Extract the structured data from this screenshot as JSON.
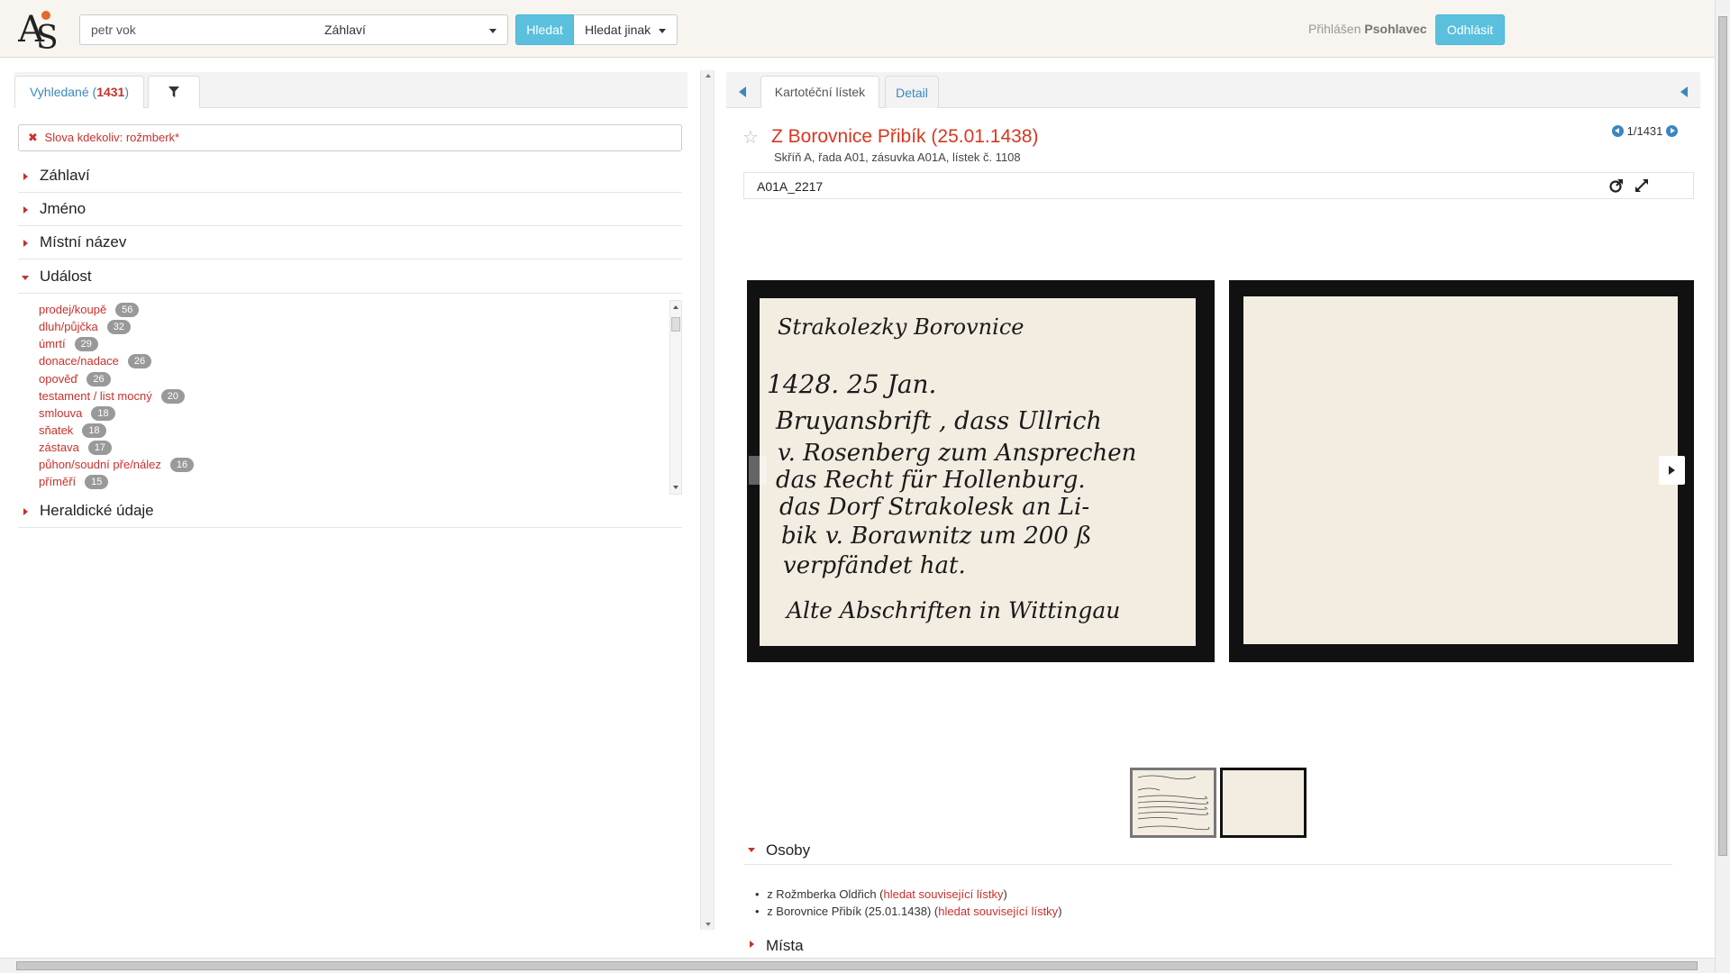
{
  "header": {
    "search_value": "petr vok",
    "field_selected": "Záhlaví",
    "search_button": "Hledat",
    "search_other_button": "Hledat jinak",
    "login_prefix": "Přihlášen",
    "login_user": "Psohlavec",
    "logout_button": "Odhlásit"
  },
  "left": {
    "tab_found_label": "Vyhledané (",
    "tab_found_count": "1431",
    "tab_found_close": ")",
    "filter_tag": "Slova kdekoliv: rožmberk*",
    "facets": [
      "Záhlaví",
      "Jméno",
      "Místní název",
      "Událost",
      "Heraldické údaje"
    ],
    "events": [
      {
        "label": "prodej/koupě",
        "count": "56"
      },
      {
        "label": "dluh/půjčka",
        "count": "32"
      },
      {
        "label": "úmrtí",
        "count": "29"
      },
      {
        "label": "donace/nadace",
        "count": "26"
      },
      {
        "label": "opověď",
        "count": "26"
      },
      {
        "label": "testament / list mocný",
        "count": "20"
      },
      {
        "label": "smlouva",
        "count": "18"
      },
      {
        "label": "sňatek",
        "count": "18"
      },
      {
        "label": "zástava",
        "count": "17"
      },
      {
        "label": "půhon/soudní pře/nález",
        "count": "16"
      },
      {
        "label": "příměří",
        "count": "15"
      }
    ]
  },
  "right": {
    "tab_card": "Kartotéční lístek",
    "tab_detail": "Detail",
    "title": "Z Borovnice Přibík (25.01.1438)",
    "subtitle": "Skříň A, řada A01, zásuvka A01A, lístek č. 1108",
    "pager": "1/1431",
    "code": "A01A_2217",
    "section_persons": "Osoby",
    "persons": [
      {
        "name": "z Rožmberka Oldřich (",
        "link": "hledat související lístky",
        "close": ")"
      },
      {
        "name": "z Borovnice Přibík (25.01.1438) (",
        "link": "hledat související lístky",
        "close": ")"
      }
    ],
    "section_places": "Místa"
  },
  "card_text": {
    "lines": [
      "Strakolezky Borovnice",
      "1428. 25 Jan.",
      "Bruyansbrift , dass Ullrich",
      "v. Rosenberg zum Ansprechen",
      "das Recht für Hollenburg.",
      "das Dorf Strakolesk an Li-",
      "bik v. Borawnitz um 200 ß",
      "verpfändet hat.",
      "Alte Abschriften in Wittingau"
    ]
  },
  "colors": {
    "accent": "#5bc0de",
    "link_red": "#c9302c",
    "link_blue": "#3a87c0",
    "header_bg": "#f8f4ef"
  }
}
